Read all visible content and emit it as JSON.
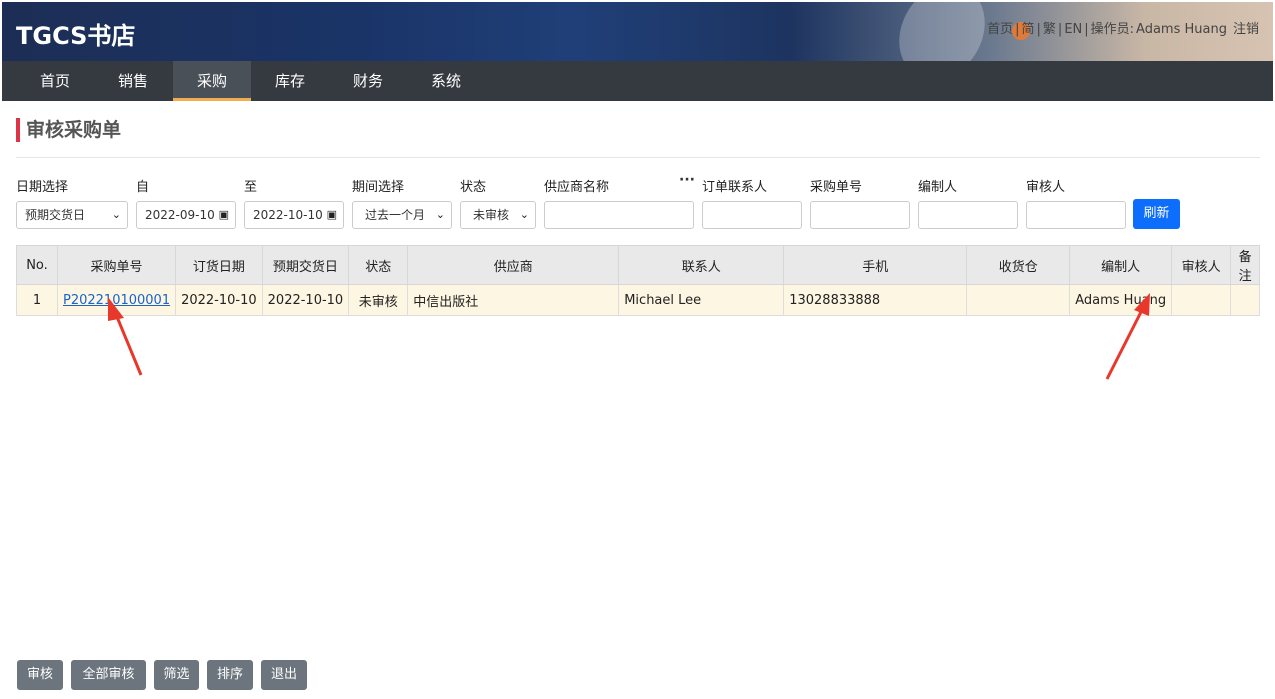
{
  "app": {
    "brand": "TGCS书店",
    "toplinks": {
      "home": "首页",
      "simplified": "简",
      "traditional": "繁",
      "english": "EN",
      "operator_label": "操作员:",
      "operator_name": "Adams Huang",
      "logout": "注销"
    }
  },
  "nav": {
    "items": [
      "首页",
      "销售",
      "采购",
      "库存",
      "财务",
      "系统"
    ],
    "active": "采购"
  },
  "page": {
    "title": "审核采购单"
  },
  "filters": {
    "labels": {
      "date_choice": "日期选择",
      "from": "自",
      "to": "至",
      "period": "期间选择",
      "status": "状态",
      "supplier": "供应商名称",
      "contact": "订单联系人",
      "po_number": "采购单号",
      "creator": "编制人",
      "reviewer": "审核人"
    },
    "values": {
      "date_choice": "预期交货日",
      "from": "2022-09-10",
      "to": "2022-10-10",
      "period": "过去一个月",
      "status": "未审核",
      "supplier": "",
      "contact": "",
      "po_number": "",
      "creator": "",
      "reviewer": ""
    },
    "more": "···",
    "refresh": "刷新"
  },
  "table": {
    "headers": [
      "No.",
      "采购单号",
      "订货日期",
      "预期交货日",
      "状态",
      "供应商",
      "联系人",
      "手机",
      "收货仓",
      "编制人",
      "审核人",
      "备注"
    ],
    "rows": [
      {
        "no": "1",
        "po": "P202210100001",
        "order_date": "2022-10-10",
        "delivery_date": "2022-10-10",
        "status": "未审核",
        "supplier": "中信出版社",
        "contact": "Michael Lee",
        "phone": "13028833888",
        "warehouse": "",
        "creator": "Adams Huang",
        "reviewer": "",
        "remark": ""
      }
    ]
  },
  "buttons": {
    "review": "审核",
    "review_all": "全部审核",
    "filter": "筛选",
    "sort": "排序",
    "exit": "退出"
  },
  "colors": {
    "nav_bg": "#343a40",
    "nav_active_border": "#f0ad4e",
    "title_accent": "#dc3545",
    "refresh_bg": "#0d6efd",
    "row_bg": "#fdf6e3",
    "arrow": "#e8372b"
  }
}
